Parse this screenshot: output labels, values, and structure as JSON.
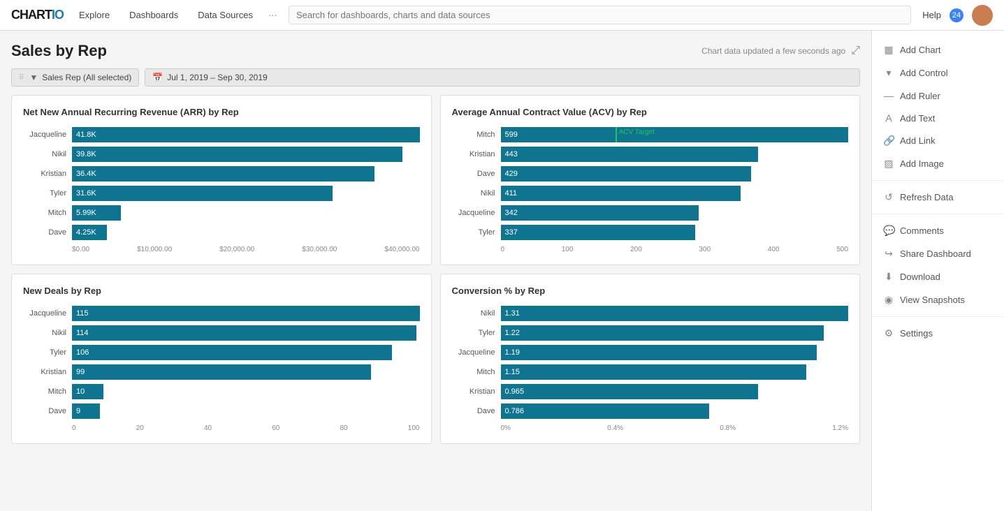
{
  "app": {
    "logo_text": "CHARTIO",
    "nav_links": [
      "Explore",
      "Dashboards",
      "Data Sources"
    ],
    "nav_dots": "···",
    "search_placeholder": "Search for dashboards, charts and data sources",
    "help_label": "Help",
    "notification_count": "24"
  },
  "dashboard": {
    "title": "Sales by Rep",
    "meta_text": "Chart data updated a few seconds ago",
    "expand_icon": "⤢",
    "filter_drag": "⠿",
    "filter_label": "Sales Rep (All selected)",
    "date_icon": "📅",
    "date_range": "Jul 1, 2019  –  Sep 30, 2019"
  },
  "chart1": {
    "title": "Net New Annual Recurring Revenue (ARR) by Rep",
    "bars": [
      {
        "label": "Jacqueline",
        "value": "41.8K",
        "pct": 100
      },
      {
        "label": "Nikil",
        "value": "39.8K",
        "pct": 95
      },
      {
        "label": "Kristian",
        "value": "36.4K",
        "pct": 87
      },
      {
        "label": "Tyler",
        "value": "31.6K",
        "pct": 75
      },
      {
        "label": "Mitch",
        "value": "5.99K",
        "pct": 14
      },
      {
        "label": "Dave",
        "value": "4.25K",
        "pct": 10
      }
    ],
    "xaxis": [
      "$0.00",
      "$10,000.00",
      "$20,000.00",
      "$30,000.00",
      "$40,000.00"
    ]
  },
  "chart2": {
    "title": "Average Annual Contract Value (ACV) by Rep",
    "bars": [
      {
        "label": "Mitch",
        "value": "599",
        "pct": 100
      },
      {
        "label": "Kristian",
        "value": "443",
        "pct": 74
      },
      {
        "label": "Dave",
        "value": "429",
        "pct": 72
      },
      {
        "label": "Nikil",
        "value": "411",
        "pct": 69
      },
      {
        "label": "Jacqueline",
        "value": "342",
        "pct": 57
      },
      {
        "label": "Tyler",
        "value": "337",
        "pct": 56
      }
    ],
    "xaxis": [
      "0",
      "100",
      "200",
      "300",
      "400",
      "500"
    ],
    "target_label": "ACV Target",
    "target_pct": 33
  },
  "chart3": {
    "title": "New Deals by Rep",
    "bars": [
      {
        "label": "Jacqueline",
        "value": "115",
        "pct": 100
      },
      {
        "label": "Nikil",
        "value": "114",
        "pct": 99
      },
      {
        "label": "Tyler",
        "value": "106",
        "pct": 92
      },
      {
        "label": "Kristian",
        "value": "99",
        "pct": 86
      },
      {
        "label": "Mitch",
        "value": "10",
        "pct": 9
      },
      {
        "label": "Dave",
        "value": "9",
        "pct": 8
      }
    ],
    "xaxis": [
      "0",
      "20",
      "40",
      "60",
      "80",
      "100"
    ]
  },
  "chart4": {
    "title": "Conversion % by Rep",
    "bars": [
      {
        "label": "Nikil",
        "value": "1.31",
        "pct": 100
      },
      {
        "label": "Tyler",
        "value": "1.22",
        "pct": 93
      },
      {
        "label": "Jacqueline",
        "value": "1.19",
        "pct": 91
      },
      {
        "label": "Mitch",
        "value": "1.15",
        "pct": 88
      },
      {
        "label": "Kristian",
        "value": "0.965",
        "pct": 74
      },
      {
        "label": "Dave",
        "value": "0.786",
        "pct": 60
      }
    ],
    "xaxis": [
      "0%",
      "0.4%",
      "0.8%",
      "1.2%"
    ]
  },
  "sidebar": {
    "items": [
      {
        "id": "add-chart",
        "icon": "📊",
        "label": "Add Chart"
      },
      {
        "id": "add-control",
        "icon": "🔽",
        "label": "Add Control"
      },
      {
        "id": "add-ruler",
        "icon": "📏",
        "label": "Add Ruler"
      },
      {
        "id": "add-text",
        "icon": "A",
        "label": "Add Text"
      },
      {
        "id": "add-link",
        "icon": "🔗",
        "label": "Add Link"
      },
      {
        "id": "add-image",
        "icon": "🖼",
        "label": "Add Image"
      },
      {
        "id": "refresh-data",
        "label": "Refresh Data",
        "icon": "🔄"
      },
      {
        "id": "comments",
        "label": "Comments",
        "icon": "💬"
      },
      {
        "id": "share-dashboard",
        "label": "Share Dashboard",
        "icon": "↪"
      },
      {
        "id": "download",
        "label": "Download",
        "icon": "⬇"
      },
      {
        "id": "view-snapshots",
        "label": "View Snapshots",
        "icon": "📷"
      },
      {
        "id": "settings",
        "label": "Settings",
        "icon": "⚙"
      }
    ]
  }
}
